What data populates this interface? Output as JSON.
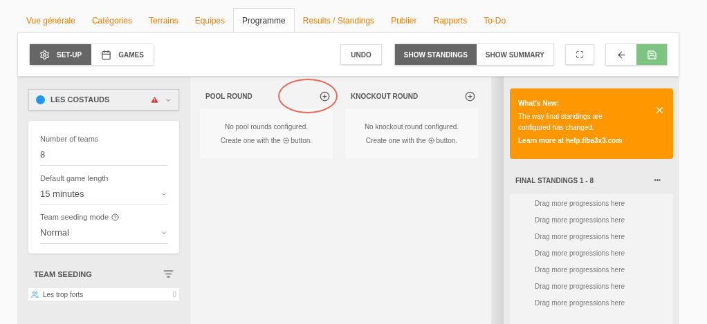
{
  "tabs": [
    {
      "label": "Vue générale",
      "selected": false
    },
    {
      "label": "Catégories",
      "selected": false
    },
    {
      "label": "Terrains",
      "selected": false
    },
    {
      "label": "Equipes",
      "selected": false
    },
    {
      "label": "Programme",
      "selected": true
    },
    {
      "label": "Results / Standings",
      "selected": false
    },
    {
      "label": "Publier",
      "selected": false
    },
    {
      "label": "Rapports",
      "selected": false
    },
    {
      "label": "To-Do",
      "selected": false
    }
  ],
  "toolbar": {
    "mode_buttons": [
      {
        "label": "SET-UP",
        "kind": "setup",
        "selected": true
      },
      {
        "label": "GAMES",
        "kind": "games",
        "selected": false
      }
    ],
    "undo": "UNDO",
    "view_buttons": [
      {
        "label": "SHOW STANDINGS",
        "selected": true
      },
      {
        "label": "SHOW SUMMARY",
        "selected": false
      }
    ]
  },
  "category": {
    "name": "LES COSTAUDS",
    "color": "#2196f3",
    "warning": true
  },
  "settings": [
    {
      "label": "Number of teams",
      "value": "8",
      "kind": "text",
      "help": false
    },
    {
      "label": "Default game length",
      "value": "15 minutes",
      "kind": "select",
      "help": false
    },
    {
      "label": "Team seeding mode",
      "value": "Normal",
      "kind": "select",
      "help": true
    }
  ],
  "team_seeding": {
    "title": "TEAM SEEDING",
    "teams": [
      {
        "name": "Les trop forts",
        "count": "0"
      }
    ]
  },
  "rounds": [
    {
      "title": "POOL ROUND",
      "lines": [
        "No pool rounds configured.",
        "Create one with the",
        "button."
      ],
      "highlighted": true
    },
    {
      "title": "KNOCKOUT ROUND",
      "lines": [
        "No knockout round configured.",
        "Create one with the",
        "button."
      ],
      "highlighted": false
    }
  ],
  "whats_new": {
    "title": "What's New:",
    "body": "The way final standings are configured has changed.",
    "link": "Learn more at help.fiba3x3.com"
  },
  "final_standings": {
    "title": "FINAL STANDINGS 1 - 8",
    "more": "•••",
    "slots": [
      "Drag more progressions here",
      "Drag more progressions here",
      "Drag more progressions here",
      "Drag more progressions here",
      "Drag more progressions here",
      "Drag more progressions here",
      "Drag more progressions here"
    ]
  }
}
